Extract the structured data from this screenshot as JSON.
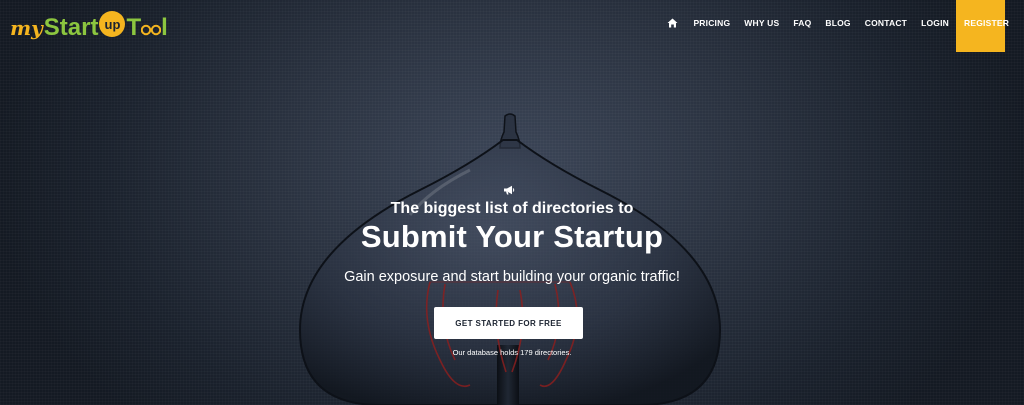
{
  "brand": {
    "my": "my",
    "start": "Start",
    "up": "up",
    "t": "T",
    "l": "l",
    "colors": {
      "yellow": "#f5b51f",
      "green": "#8cc63f"
    }
  },
  "nav": {
    "home_icon": "home-icon",
    "items": [
      "PRICING",
      "WHY US",
      "FAQ",
      "BLOG",
      "CONTACT",
      "LOGIN"
    ],
    "register": "REGISTER"
  },
  "hero": {
    "icon": "megaphone-icon",
    "subhead": "The biggest list of directories to",
    "headline": "Submit Your Startup",
    "tagline": "Gain exposure and start building your organic traffic!",
    "cta": "GET STARTED FOR FREE",
    "db_note": "Our database holds 179 directories."
  },
  "colors": {
    "background": "#1b2330",
    "accent": "#f5b51f",
    "button_bg": "#ffffff"
  }
}
